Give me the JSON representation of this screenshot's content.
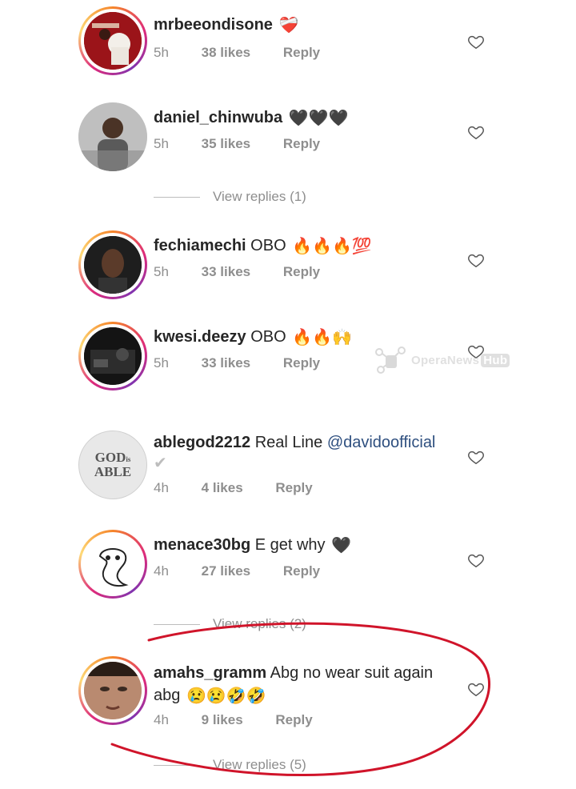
{
  "comments": [
    {
      "username": "mrbeeondisone",
      "text": "",
      "emojis": "❤️‍🩹",
      "time": "5h",
      "likes": "38 likes",
      "reply": "Reply"
    },
    {
      "username": "daniel_chinwuba",
      "text": "",
      "emojis": "🖤🖤🖤",
      "time": "5h",
      "likes": "35 likes",
      "reply": "Reply"
    },
    {
      "username": "fechiamechi",
      "text": "OBO",
      "emojis": "🔥🔥🔥💯",
      "time": "5h",
      "likes": "33 likes",
      "reply": "Reply"
    },
    {
      "username": "kwesi.deezy",
      "text": "OBO",
      "emojis": "🔥🔥🙌",
      "time": "5h",
      "likes": "33 likes",
      "reply": "Reply"
    },
    {
      "username": "ablegod2212",
      "text": "Real Line",
      "mention": "@davidoofficial",
      "line2": "✔",
      "time": "4h",
      "likes": "4 likes",
      "reply": "Reply"
    },
    {
      "username": "menace30bg",
      "text": "E get why",
      "emojis": "🖤",
      "time": "4h",
      "likes": "27 likes",
      "reply": "Reply"
    },
    {
      "username": "amahs_gramm",
      "text": "Abg no wear suit again",
      "line2": "abg",
      "emojis": "😢😢🤣🤣",
      "time": "4h",
      "likes": "9 likes",
      "reply": "Reply"
    }
  ],
  "view_replies": [
    "View replies (1)",
    "View replies (2)",
    "View replies (5)"
  ],
  "avatar_text": {
    "godisable_top": "GOD",
    "godisable_is": "is",
    "godisable_bottom": "ABLE"
  },
  "watermark": {
    "text": "OperaNews",
    "hub": "Hub"
  },
  "colors": {
    "annotation_red": "#d0142a",
    "ring_gradient": [
      "#f58529",
      "#dd2a7b",
      "#8134af"
    ]
  }
}
